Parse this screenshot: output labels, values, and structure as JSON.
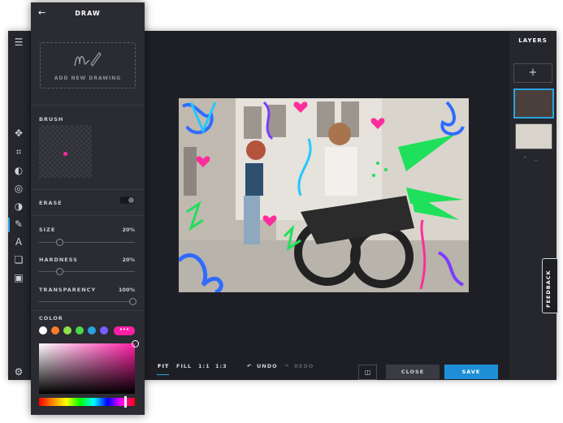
{
  "panel": {
    "title": "DRAW",
    "add_drawing": "ADD NEW DRAWING",
    "brush_label": "BRUSH",
    "erase_label": "ERASE",
    "size": {
      "label": "SIZE",
      "value": "20%",
      "fraction": 0.2
    },
    "hardness": {
      "label": "HARDNESS",
      "value": "20%",
      "fraction": 0.2
    },
    "transparency": {
      "label": "TRANSPARENCY",
      "value": "100%",
      "fraction": 1.0
    },
    "color_label": "COLOR",
    "swatches": [
      "#ffffff",
      "#ff7a2a",
      "#8fe04a",
      "#4cd64c",
      "#2aa3e0",
      "#7b5cff"
    ],
    "more_label": "•••",
    "selected_color": "#ff1fa6"
  },
  "layers": {
    "title": "LAYERS",
    "add_label": "+"
  },
  "feedback_label": "FEEDBACK",
  "bottom": {
    "fit": "FIT",
    "fill": "FILL",
    "one_one": "1:1",
    "one_three": "1:3",
    "undo": "UNDO",
    "redo": "REDO",
    "close": "CLOSE",
    "save": "SAVE"
  },
  "colors": {
    "accent": "#2aa3e0",
    "save": "#1e8fd6",
    "brush": "#ff1fa6"
  }
}
